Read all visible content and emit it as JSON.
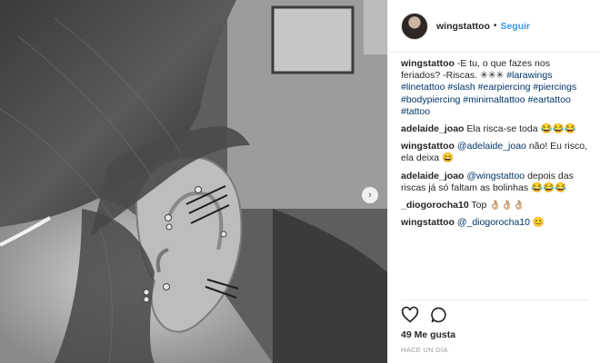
{
  "post": {
    "user": "wingstattoo",
    "separator": "•",
    "follow_label": "Seguir",
    "caption": {
      "user": "wingstattoo",
      "text": "-E tu, o que fazes nos feriados? -Riscas. ✳✳✳",
      "hashtags": "#larawings #linetattoo #slash #earpiercing #piercings #bodypiercing #minimaltattoo #eartattoo #tattoo"
    },
    "comments": [
      {
        "user": "adelaide_joao",
        "text": "Ela risca-se toda 😂😂😂",
        "mention": ""
      },
      {
        "user": "wingstattoo",
        "mention": "@adelaide_joao",
        "text": " não! Eu risco, ela deixa 😄"
      },
      {
        "user": "adelaide_joao",
        "mention": "@wingstattoo",
        "text": " depois das riscas já só faltam as bolinhas 😂😂😂"
      },
      {
        "user": "_diogorocha10",
        "text": "Top 👌🏼👌🏼👌🏼",
        "mention": ""
      },
      {
        "user": "wingstattoo",
        "mention": "@_diogorocha10",
        "text": " 😊"
      }
    ],
    "likes": "49 Me gusta",
    "time": "HACE UN DÍA",
    "next_arrow": "›",
    "icons": [
      "heart-icon",
      "comment-icon",
      "chevron-right-icon"
    ]
  }
}
